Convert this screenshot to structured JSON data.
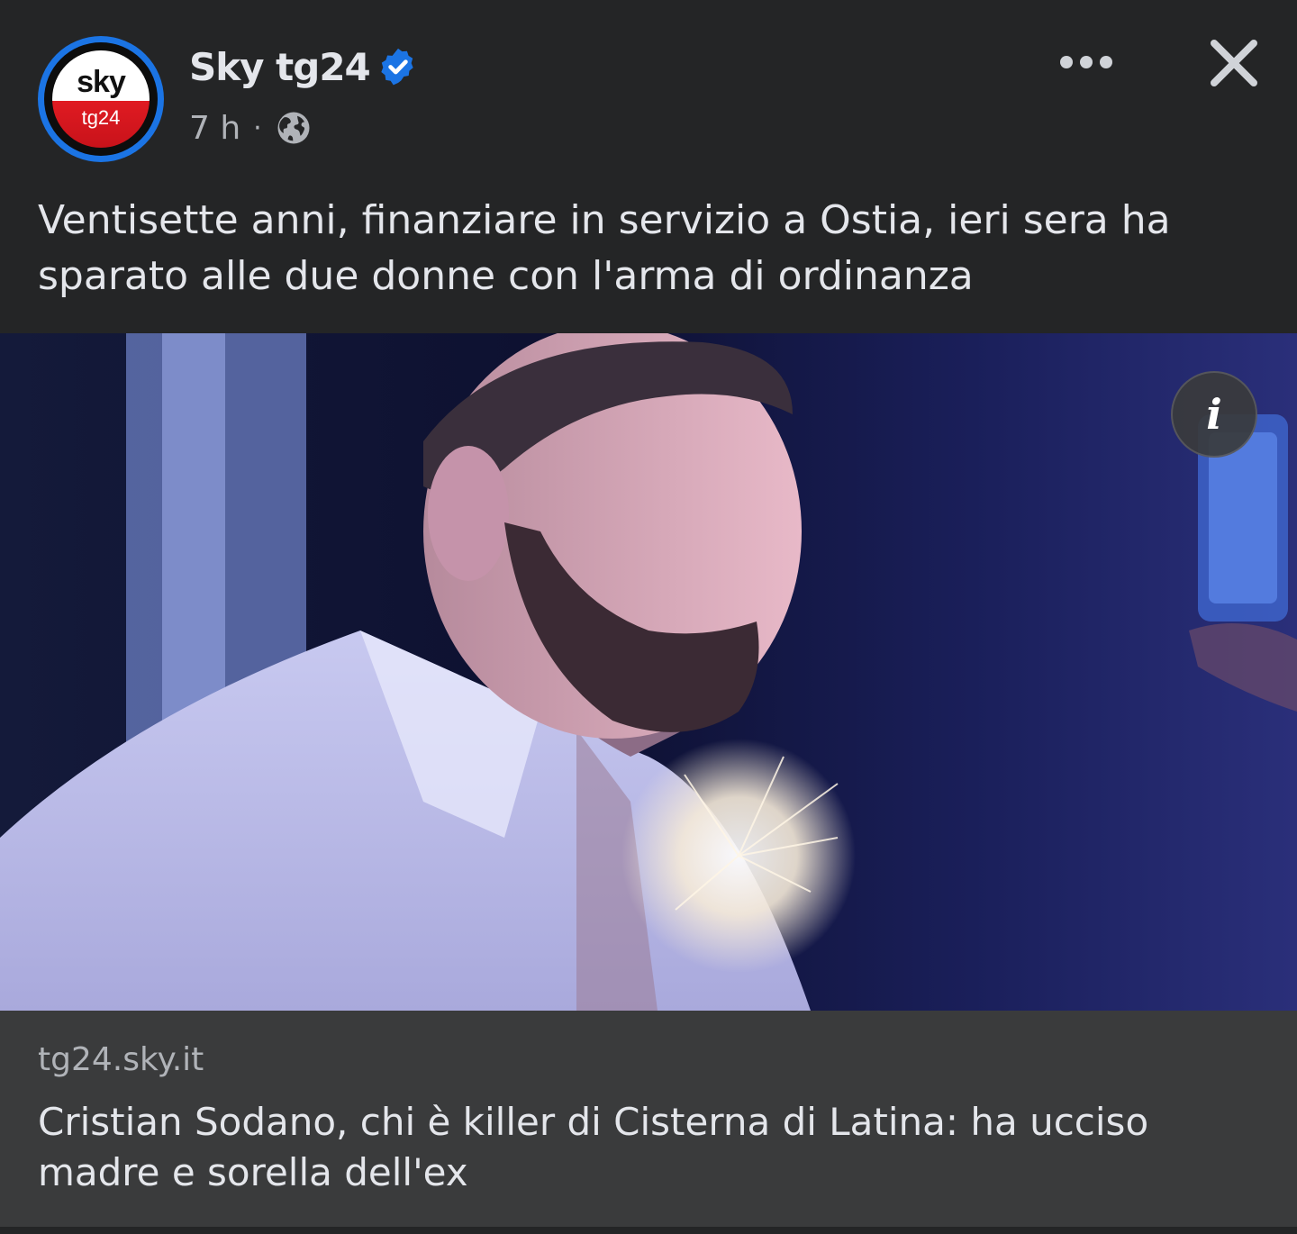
{
  "header": {
    "page_name": "Sky tg24",
    "avatar_text_top": "sky",
    "avatar_text_bottom": "tg24",
    "time": "7 h",
    "separator": "·",
    "audience_icon": "globe-icon",
    "verified_icon": "verified-badge-icon",
    "more_icon": "more-options-icon",
    "close_icon": "close-icon"
  },
  "post": {
    "caption": "Ventisette anni, finanziare in servizio a Ostia, ieri sera ha sparato alle due donne con l'arma di ordinanza"
  },
  "image": {
    "info_label": "i",
    "info_icon": "info-icon"
  },
  "link": {
    "domain": "tg24.sky.it",
    "title": "Cristian Sodano, chi è killer di Cisterna di Latina: ha ucciso madre e sorella dell'ex"
  },
  "colors": {
    "background": "#242526",
    "link_card": "#3a3b3c",
    "accent": "#1b74e4",
    "brand_red": "#e01b22"
  }
}
